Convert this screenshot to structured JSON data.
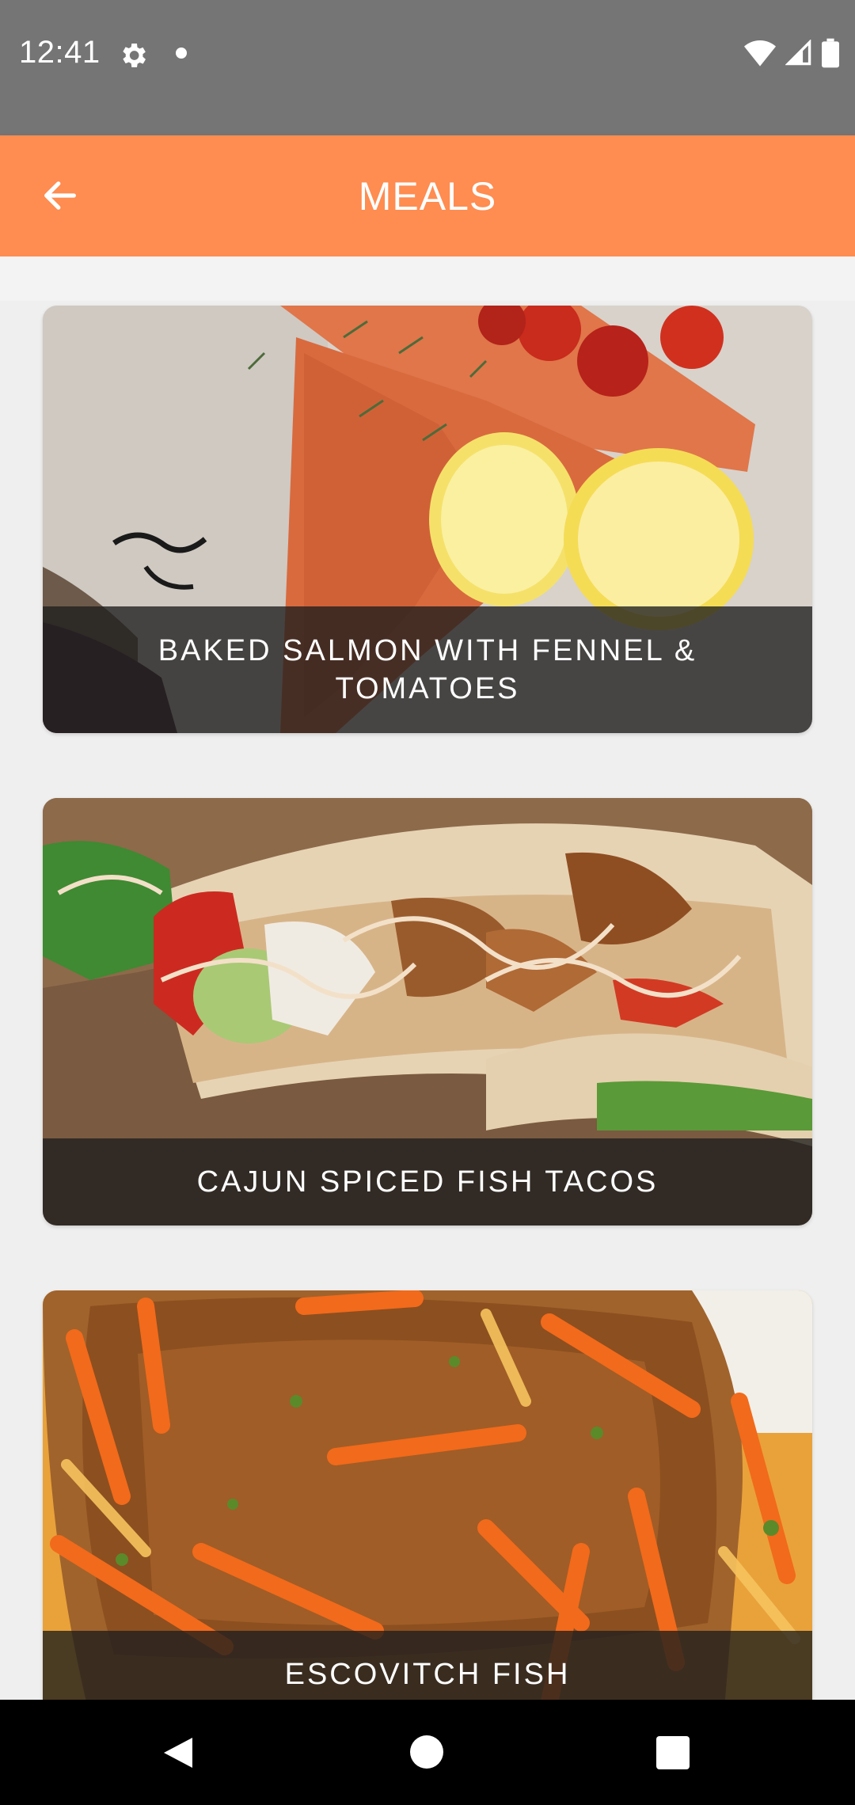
{
  "status_bar": {
    "time": "12:41",
    "icons": [
      "settings-gear-icon",
      "notification-dot-icon",
      "wifi-icon",
      "cellular-signal-icon",
      "battery-icon"
    ]
  },
  "app_bar": {
    "title": "MEALS",
    "back_icon": "arrow-back-icon",
    "background_color": "#ff8c50"
  },
  "meals": [
    {
      "title": "BAKED SALMON WITH FENNEL & TOMATOES"
    },
    {
      "title": "CAJUN SPICED FISH TACOS"
    },
    {
      "title": "ESCOVITCH FISH"
    }
  ],
  "nav_bar": {
    "icons": [
      "nav-back-icon",
      "nav-home-icon",
      "nav-recents-icon"
    ]
  }
}
